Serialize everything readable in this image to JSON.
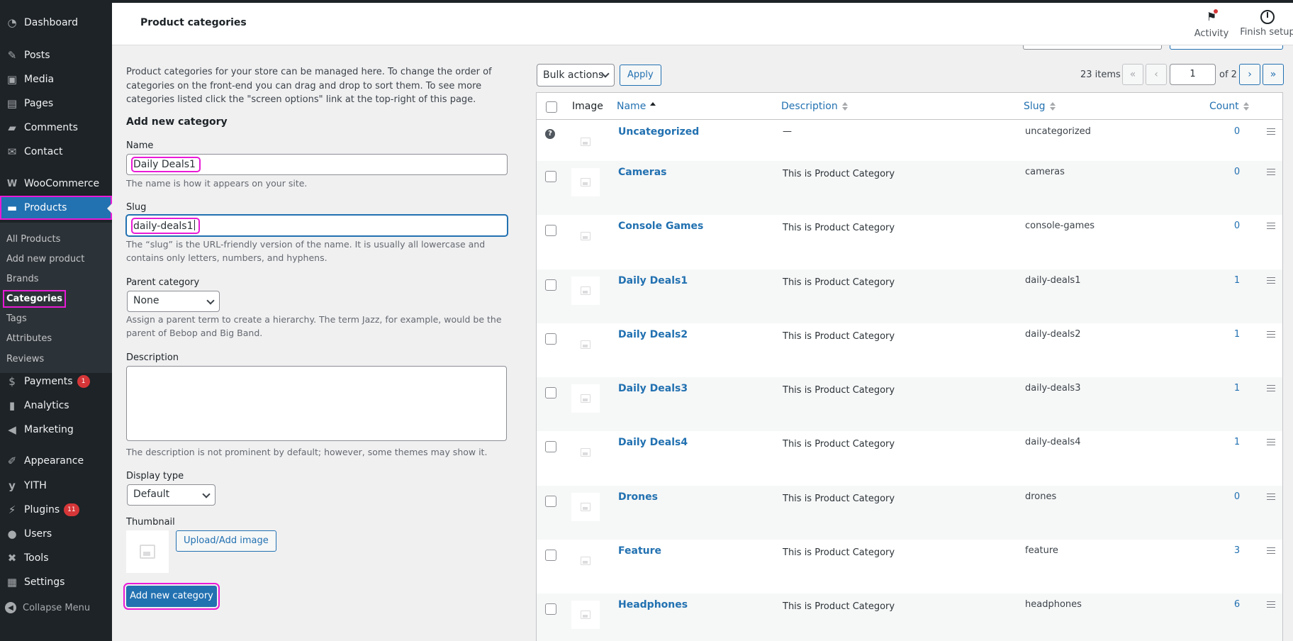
{
  "header": {
    "title": "Product categories",
    "activity_label": "Activity",
    "finish_label": "Finish setup"
  },
  "sidebar": {
    "items": [
      {
        "label": "Dashboard",
        "icon": "dashboard-icon"
      },
      {
        "label": "Posts",
        "icon": "pin-icon"
      },
      {
        "label": "Media",
        "icon": "media-icon"
      },
      {
        "label": "Pages",
        "icon": "pages-icon"
      },
      {
        "label": "Comments",
        "icon": "comment-icon"
      },
      {
        "label": "Contact",
        "icon": "envelope-icon"
      },
      {
        "label": "WooCommerce",
        "icon": "woocommerce-icon"
      },
      {
        "label": "Products",
        "icon": "archive-icon"
      },
      {
        "label": "Payments",
        "icon": "dollar-icon",
        "badge": "1"
      },
      {
        "label": "Analytics",
        "icon": "bar-chart-icon"
      },
      {
        "label": "Marketing",
        "icon": "megaphone-icon"
      },
      {
        "label": "Appearance",
        "icon": "brush-icon"
      },
      {
        "label": "YITH",
        "icon": "yith-icon"
      },
      {
        "label": "Plugins",
        "icon": "plug-icon",
        "badge": "11"
      },
      {
        "label": "Users",
        "icon": "user-icon"
      },
      {
        "label": "Tools",
        "icon": "wrench-icon"
      },
      {
        "label": "Settings",
        "icon": "settings-icon"
      }
    ],
    "submenu": [
      "All Products",
      "Add new product",
      "Brands",
      "Categories",
      "Tags",
      "Attributes",
      "Reviews"
    ],
    "collapse_label": "Collapse Menu"
  },
  "form": {
    "intro": "Product categories for your store can be managed here. To change the order of categories on the front-end you can drag and drop to sort them. To see more categories listed click the \"screen options\" link at the top-right of this page.",
    "heading": "Add new category",
    "name_label": "Name",
    "name_value": "Daily Deals1",
    "name_help": "The name is how it appears on your site.",
    "slug_label": "Slug",
    "slug_value": "daily-deals1",
    "slug_help": "The “slug” is the URL-friendly version of the name. It is usually all lowercase and contains only letters, numbers, and hyphens.",
    "parent_label": "Parent category",
    "parent_value": "None",
    "parent_help": "Assign a parent term to create a hierarchy. The term Jazz, for example, would be the parent of Bebop and Big Band.",
    "description_label": "Description",
    "description_help": "The description is not prominent by default; however, some themes may show it.",
    "display_label": "Display type",
    "display_value": "Default",
    "thumbnail_label": "Thumbnail",
    "upload_button": "Upload/Add image",
    "submit_button": "Add new category"
  },
  "toolbar": {
    "bulk_actions": "Bulk actions",
    "apply": "Apply",
    "items_count": "23 items",
    "first": "«",
    "prev": "‹",
    "current_page": "1",
    "of_pages": "of 2",
    "next": "›",
    "last": "»"
  },
  "table": {
    "headers": {
      "image": "Image",
      "name": "Name",
      "description": "Description",
      "slug": "Slug",
      "count": "Count"
    },
    "rows": [
      {
        "name": "Uncategorized",
        "description": "—",
        "slug": "uncategorized",
        "count": "0"
      },
      {
        "name": "Cameras",
        "description": "This is Product Category",
        "slug": "cameras",
        "count": "0"
      },
      {
        "name": "Console Games",
        "description": "This is Product Category",
        "slug": "console-games",
        "count": "0"
      },
      {
        "name": "Daily Deals1",
        "description": "This is Product Category",
        "slug": "daily-deals1",
        "count": "1"
      },
      {
        "name": "Daily Deals2",
        "description": "This is Product Category",
        "slug": "daily-deals2",
        "count": "1"
      },
      {
        "name": "Daily Deals3",
        "description": "This is Product Category",
        "slug": "daily-deals3",
        "count": "1"
      },
      {
        "name": "Daily Deals4",
        "description": "This is Product Category",
        "slug": "daily-deals4",
        "count": "1"
      },
      {
        "name": "Drones",
        "description": "This is Product Category",
        "slug": "drones",
        "count": "0"
      },
      {
        "name": "Feature",
        "description": "This is Product Category",
        "slug": "feature",
        "count": "3"
      },
      {
        "name": "Headphones",
        "description": "This is Product Category",
        "slug": "headphones",
        "count": "6"
      }
    ]
  },
  "colors": {
    "sidebar_bg": "#1d2327",
    "accent": "#2271b1",
    "highlight": "#e91ad6",
    "badge": "#d63638"
  }
}
